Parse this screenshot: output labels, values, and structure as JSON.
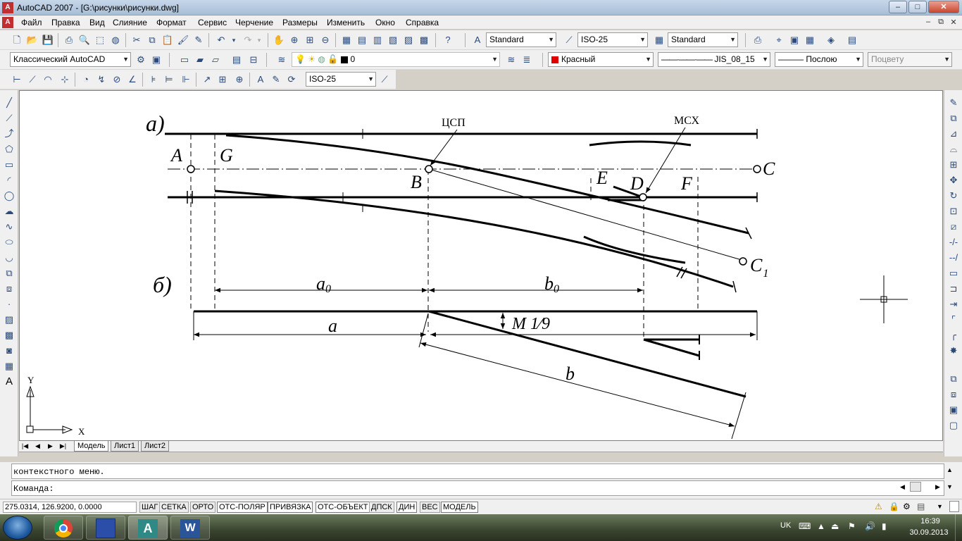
{
  "window": {
    "title": "AutoCAD 2007 - [G:\\рисунки\\рисунки.dwg]",
    "app_icon": "A",
    "min": "–",
    "max": "□",
    "close": "✕"
  },
  "menu": {
    "items": [
      "Файл",
      "Правка",
      "Вид",
      "Слияние",
      "Формат",
      "Сервис",
      "Черчение",
      "Размеры",
      "Изменить",
      "Окно",
      "Справка"
    ],
    "doc_min": "–",
    "doc_restore": "⧉",
    "doc_close": "✕"
  },
  "toolbar1": {
    "text_style": "Standard",
    "dim_style": "ISO-25",
    "table_style": "Standard"
  },
  "toolbar2": {
    "workspace": "Классический AutoCAD",
    "layer": "0",
    "color": "Красный",
    "color_hex": "#e00000",
    "linetype": "JIS_08_15",
    "lineweight": "Послою",
    "plotstyle": "Поцвету"
  },
  "toolbar3": {
    "dim_style": "ISO-25"
  },
  "drawing": {
    "label_a": "а)",
    "label_b": "б)",
    "csp": "ЦСП",
    "msh": "МСХ",
    "pt_A": "A",
    "pt_G": "G",
    "pt_B": "B",
    "pt_E": "E",
    "pt_D": "D",
    "pt_F": "F",
    "pt_C": "C",
    "pt_C1": "C",
    "pt_C1_sub": "1",
    "dim_a0": "a",
    "dim_a0_sub": "0",
    "dim_b0": "b",
    "dim_b0_sub": "0",
    "dim_a": "a",
    "dim_b": "b",
    "slope": "M 1⁄9",
    "ucs_x": "X",
    "ucs_y": "Y"
  },
  "layout_tabs": {
    "model": "Модель",
    "sheet1": "Лист1",
    "sheet2": "Лист2"
  },
  "command": {
    "history": "контекстного меню.",
    "prompt": "Команда:"
  },
  "status": {
    "coords": "275.0314, 126.9200, 0.0000",
    "buttons": [
      "ШАГ",
      "СЕТКА",
      "ОРТО",
      "ОТС-ПОЛЯР",
      "ПРИВЯЗКА",
      "ОТС-ОБЪЕКТ",
      "ДПСК",
      "ДИН",
      "ВЕС",
      "МОДЕЛЬ"
    ]
  },
  "taskbar": {
    "lang": "UK",
    "time": "16:39",
    "date": "30.09.2013"
  }
}
